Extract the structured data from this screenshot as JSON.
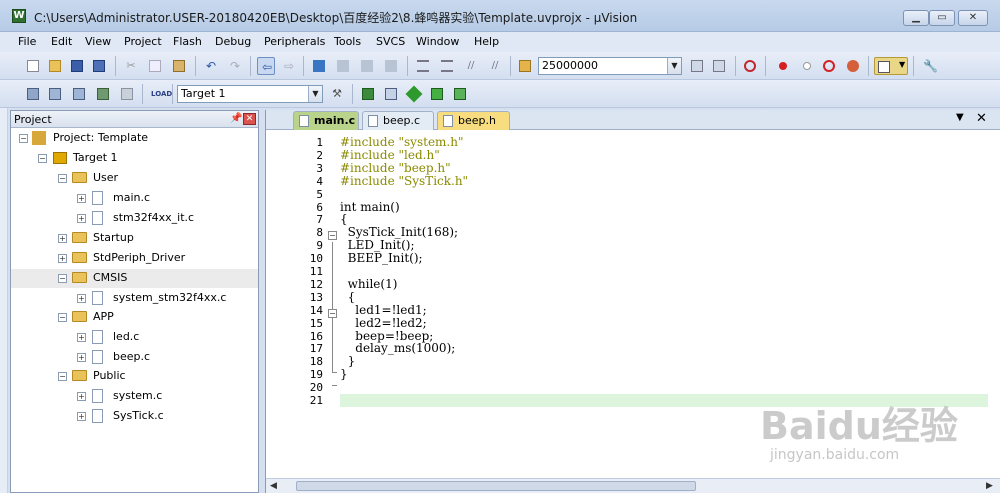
{
  "window": {
    "title": "C:\\Users\\Administrator.USER-20180420EB\\Desktop\\百度经验2\\8.蜂鸣器实验\\Template.uvprojx - µVision"
  },
  "menu": [
    "File",
    "Edit",
    "View",
    "Project",
    "Flash",
    "Debug",
    "Peripherals",
    "Tools",
    "SVCS",
    "Window",
    "Help"
  ],
  "toolbar1": {
    "frequency_value": "25000000"
  },
  "toolbar2": {
    "target_value": "Target 1"
  },
  "project_pane": {
    "title": "Project",
    "tree": [
      {
        "label": "Project: Template",
        "kind": "project"
      },
      {
        "label": "Target 1",
        "kind": "target"
      },
      {
        "label": "User",
        "kind": "folder"
      },
      {
        "label": "main.c",
        "kind": "file"
      },
      {
        "label": "stm32f4xx_it.c",
        "kind": "file"
      },
      {
        "label": "Startup",
        "kind": "folder"
      },
      {
        "label": "StdPeriph_Driver",
        "kind": "folder"
      },
      {
        "label": "CMSIS",
        "kind": "folder"
      },
      {
        "label": "system_stm32f4xx.c",
        "kind": "file"
      },
      {
        "label": "APP",
        "kind": "folder"
      },
      {
        "label": "led.c",
        "kind": "file"
      },
      {
        "label": "beep.c",
        "kind": "file"
      },
      {
        "label": "Public",
        "kind": "folder"
      },
      {
        "label": "system.c",
        "kind": "file"
      },
      {
        "label": "SysTick.c",
        "kind": "file"
      }
    ]
  },
  "editor": {
    "tabs": [
      "main.c",
      "beep.c",
      "beep.h"
    ],
    "active_tab": "main.c",
    "line_numbers": [
      "1",
      "2",
      "3",
      "4",
      "5",
      "6",
      "7",
      "8",
      "9",
      "10",
      "11",
      "12",
      "13",
      "14",
      "15",
      "16",
      "17",
      "18",
      "19",
      "20",
      "21"
    ],
    "lines": [
      "#include \"system.h\"",
      "#include \"led.h\"",
      "#include \"beep.h\"",
      "#include \"SysTick.h\"",
      "",
      "int main()",
      "{",
      "  SysTick_Init(168);",
      "  LED_Init();",
      "  BEEP_Init();",
      "",
      "  while(1)",
      "  {",
      "    led1=!led1;",
      "    led2=!led2;",
      "    beep=!beep;",
      "    delay_ms(1000);",
      "  }",
      "}",
      "",
      ""
    ]
  },
  "watermark": {
    "text": "Baidu经验",
    "sub": "jingyan.baidu.com"
  },
  "colors": {
    "active_tab": "#b9d38b",
    "highlight_tab": "#f7dd80",
    "current_line": "#dcf5dc",
    "include_color": "#8a8a00",
    "keyword_color": "#0000ff",
    "number_color": "#008080"
  }
}
